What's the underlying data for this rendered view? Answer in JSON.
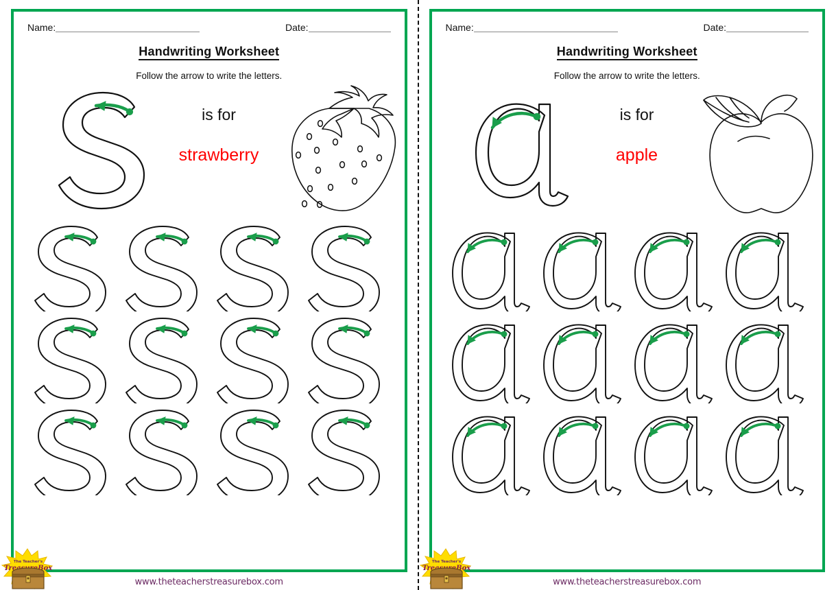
{
  "worksheet_type": "handwriting-tracing-worksheet",
  "colors": {
    "border_green": "#00a651",
    "arrow_green": "#1a9e4b",
    "word_red": "#ff0000",
    "url_purple": "#6b2a63",
    "rule_gray": "#8a8a8a",
    "outline_black": "#111111"
  },
  "pages": [
    {
      "name_label": "Name:",
      "date_label": "Date:",
      "title": "Handwriting Worksheet",
      "subtitle": "Follow the arrow to write the letters.",
      "letter": "S",
      "letter_case": "uppercase",
      "is_for_label": "is for",
      "word": "strawberry",
      "picture": "strawberry-illustration",
      "practice_rows": 3,
      "practice_per_row": 4,
      "url": "www.theteacherstreasurebox.com",
      "logo_line1": "The Teacher's",
      "logo_line2": "Treasure Box"
    },
    {
      "name_label": "Name:",
      "date_label": "Date:",
      "title": "Handwriting Worksheet",
      "subtitle": "Follow the arrow to write the letters.",
      "letter": "a",
      "letter_case": "lowercase",
      "is_for_label": "is for",
      "word": "apple",
      "picture": "apple-illustration",
      "practice_rows": 3,
      "practice_per_row": 4,
      "url": "www.theteacherstreasurebox.com",
      "logo_line1": "The Teacher's",
      "logo_line2": "Treasure Box"
    }
  ]
}
